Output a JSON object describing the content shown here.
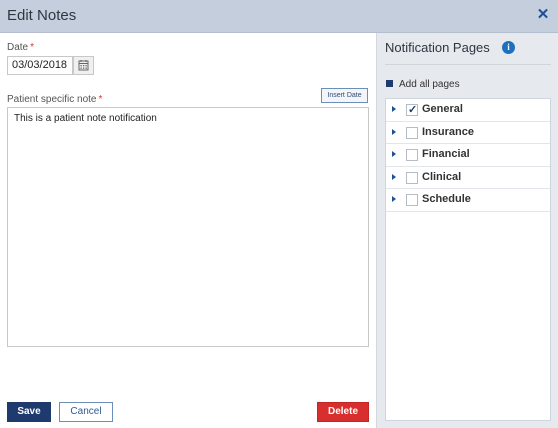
{
  "dialog": {
    "title": "Edit Notes"
  },
  "form": {
    "date_label": "Date",
    "required_mark": "*",
    "date_value": "03/03/2018",
    "note_label": "Patient specific note",
    "insert_date_label": "Insert Date",
    "note_text": "This is a patient note notification"
  },
  "actions": {
    "save": "Save",
    "cancel": "Cancel",
    "delete": "Delete"
  },
  "notification_pages": {
    "title": "Notification Pages",
    "add_all_label": "Add all pages",
    "items": [
      {
        "label": "General",
        "checked": true
      },
      {
        "label": "Insurance",
        "checked": false
      },
      {
        "label": "Financial",
        "checked": false
      },
      {
        "label": "Clinical",
        "checked": false
      },
      {
        "label": "Schedule",
        "checked": false
      }
    ]
  },
  "colors": {
    "primary": "#1f3a6e",
    "danger": "#d92e2e",
    "header": "#c5cedd",
    "panel": "#e6e9ee"
  }
}
